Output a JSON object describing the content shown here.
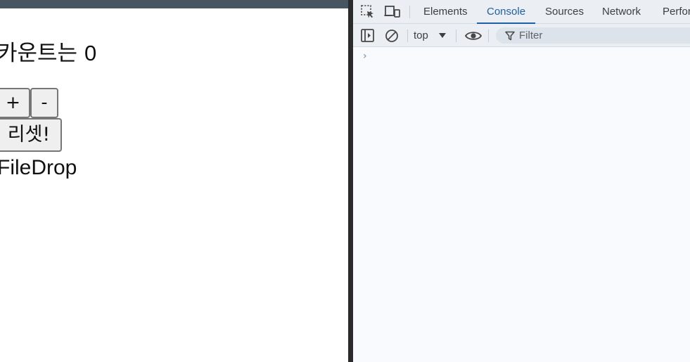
{
  "page": {
    "count_prefix": "카운트는",
    "count_value": "0",
    "plus_label": "+",
    "minus_label": "-",
    "reset_label": "리셋!",
    "filedrop_text": "FileDrop"
  },
  "devtools": {
    "tabs": [
      {
        "label": "Elements",
        "active": false
      },
      {
        "label": "Console",
        "active": true
      },
      {
        "label": "Sources",
        "active": false
      },
      {
        "label": "Network",
        "active": false
      },
      {
        "label": "Perfor",
        "active": false
      }
    ],
    "context_value": "top",
    "filter_placeholder": "Filter",
    "prompt_symbol": "›"
  },
  "colors": {
    "accent": "#1f5fa8",
    "topbar": "#46555f",
    "devtools_bg": "#f8fafd",
    "devtools_toolbar": "#ebeff4"
  }
}
